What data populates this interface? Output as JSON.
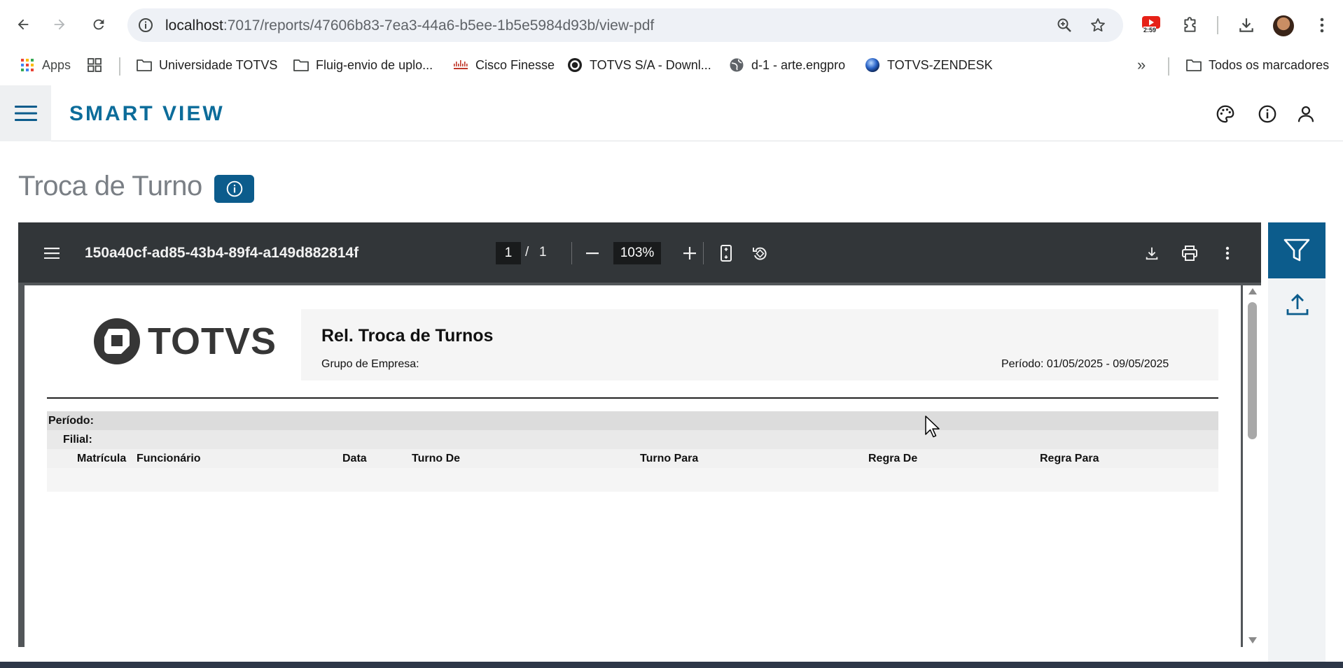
{
  "browser": {
    "url_host": "localhost",
    "url_path": ":7017/reports/47606b83-7ea3-44a6-b5ee-1b5e5984d93b/view-pdf",
    "extension_badge": "2:59",
    "bookmarks": [
      {
        "label": "Apps",
        "icon": "apps-grid-icon"
      },
      {
        "label": "",
        "icon": "tab-groups-icon"
      },
      {
        "label": "Universidade TOTVS",
        "icon": "folder-icon"
      },
      {
        "label": "Fluig-envio de uplo...",
        "icon": "folder-icon"
      },
      {
        "label": "Cisco Finesse",
        "icon": "cisco-icon"
      },
      {
        "label": "TOTVS S/A - Downl...",
        "icon": "totvs-icon"
      },
      {
        "label": "d-1 - arte.engpro",
        "icon": "globe-icon"
      },
      {
        "label": "TOTVS-ZENDESK",
        "icon": "zendesk-icon"
      }
    ],
    "all_bookmarks": "Todos os marcadores",
    "more_bookmarks": "»"
  },
  "app": {
    "brand": "SMART VIEW",
    "page_title": "Troca de Turno"
  },
  "pdf": {
    "file_name": "150a40cf-ad85-43b4-89f4-a149d882814f",
    "current_page": "1",
    "page_separator": "/",
    "total_pages": "1",
    "zoom": "103%"
  },
  "report": {
    "logo_text": "TOTVS",
    "title": "Rel. Troca de Turnos",
    "group_label": "Grupo de Empresa:",
    "period_header": "Período: 01/05/2025  -  09/05/2025",
    "period_label": "Período:",
    "branch_label": "Filial:",
    "columns": [
      "Matrícula",
      "Funcionário",
      "Data",
      "Turno De",
      "Turno Para",
      "Regra De",
      "Regra Para"
    ]
  },
  "colors": {
    "brand": "#0c6c9a",
    "accent": "#0c5c8c",
    "pdf_toolbar": "#323639"
  }
}
